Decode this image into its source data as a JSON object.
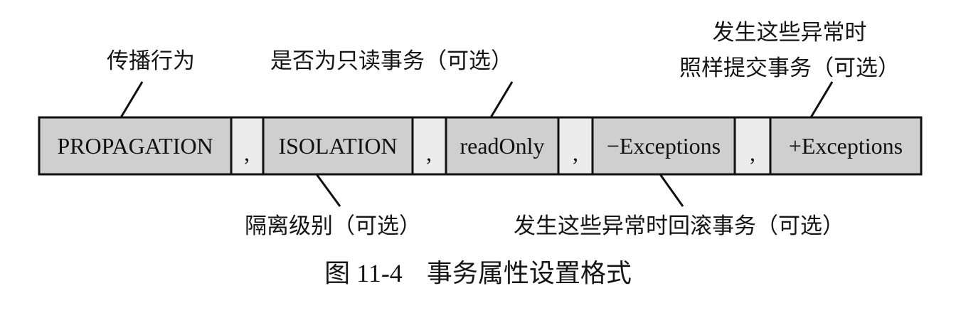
{
  "segments": [
    {
      "label": "PROPAGATION"
    },
    {
      "label": ","
    },
    {
      "label": "ISOLATION"
    },
    {
      "label": ","
    },
    {
      "label": "readOnly"
    },
    {
      "label": ","
    },
    {
      "label": "−Exceptions"
    },
    {
      "label": ","
    },
    {
      "label": "+Exceptions"
    }
  ],
  "colors": {
    "field_fill": "#cfcfcf",
    "separator_fill": "#ececec",
    "stroke": "#111111"
  },
  "annotations": {
    "propagation": "传播行为",
    "readonly": "是否为只读事务（可选）",
    "commit_line1": "发生这些异常时",
    "commit_line2": "照样提交事务（可选）",
    "isolation": "隔离级别（可选）",
    "rollback": "发生这些异常时回滚事务（可选）"
  },
  "caption": {
    "number": "图 11-4",
    "title": "事务属性设置格式"
  }
}
